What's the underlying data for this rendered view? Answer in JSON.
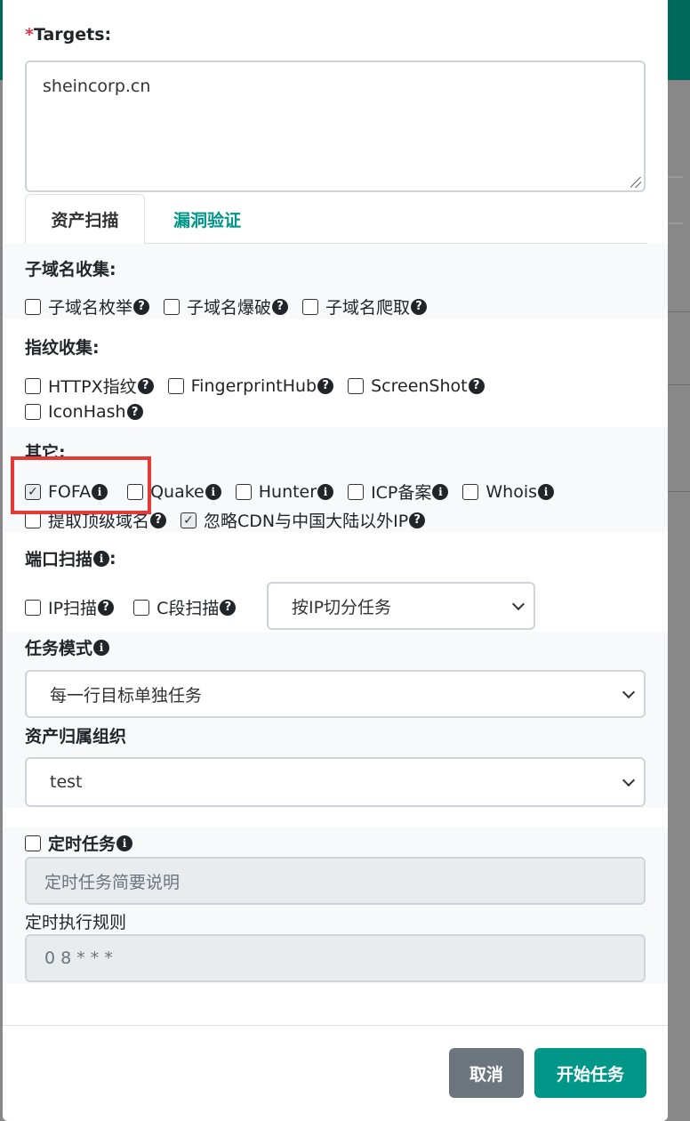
{
  "targets": {
    "required_mark": "*",
    "label": "Targets:",
    "value": "sheincorp.cn"
  },
  "tabs": [
    {
      "label": "资产扫描",
      "active": true
    },
    {
      "label": "漏洞验证",
      "active": false
    }
  ],
  "subdomain": {
    "title": "子域名收集:",
    "options": [
      {
        "label": "子域名枚举",
        "checked": false
      },
      {
        "label": "子域名爆破",
        "checked": false
      },
      {
        "label": "子域名爬取",
        "checked": false
      }
    ]
  },
  "fingerprint": {
    "title": "指纹收集:",
    "options": [
      {
        "label": "HTTPX指纹",
        "checked": false
      },
      {
        "label": "FingerprintHub",
        "checked": false
      },
      {
        "label": "ScreenShot",
        "checked": false
      },
      {
        "label": "IconHash",
        "checked": false
      }
    ]
  },
  "other": {
    "title": "其它:",
    "options": [
      {
        "label": "FOFA",
        "checked": true
      },
      {
        "label": "Quake",
        "checked": false
      },
      {
        "label": "Hunter",
        "checked": false
      },
      {
        "label": "ICP备案",
        "checked": false
      },
      {
        "label": "Whois",
        "checked": false
      },
      {
        "label": "提取顶级域名",
        "checked": false
      },
      {
        "label": "忽略CDN与中国大陆以外IP",
        "checked": true
      }
    ]
  },
  "port_scan": {
    "title": "端口扫描",
    "title_suffix": ":",
    "options": [
      {
        "label": "IP扫描",
        "checked": false
      },
      {
        "label": "C段扫描",
        "checked": false
      }
    ],
    "split_select": "按IP切分任务"
  },
  "task_mode": {
    "label": "任务模式",
    "value": "每一行目标单独任务"
  },
  "org": {
    "label": "资产归属组织",
    "value": "test"
  },
  "schedule": {
    "label": "定时任务",
    "checked": false,
    "desc_placeholder": "定时任务简要说明",
    "rule_label": "定时执行规则",
    "rule_value": "0 8 * * *"
  },
  "buttons": {
    "cancel": "取消",
    "start": "开始任务"
  },
  "colors": {
    "accent": "#009688",
    "header": "#00695c",
    "cancel": "#6c757d",
    "highlight": "#e53935"
  }
}
